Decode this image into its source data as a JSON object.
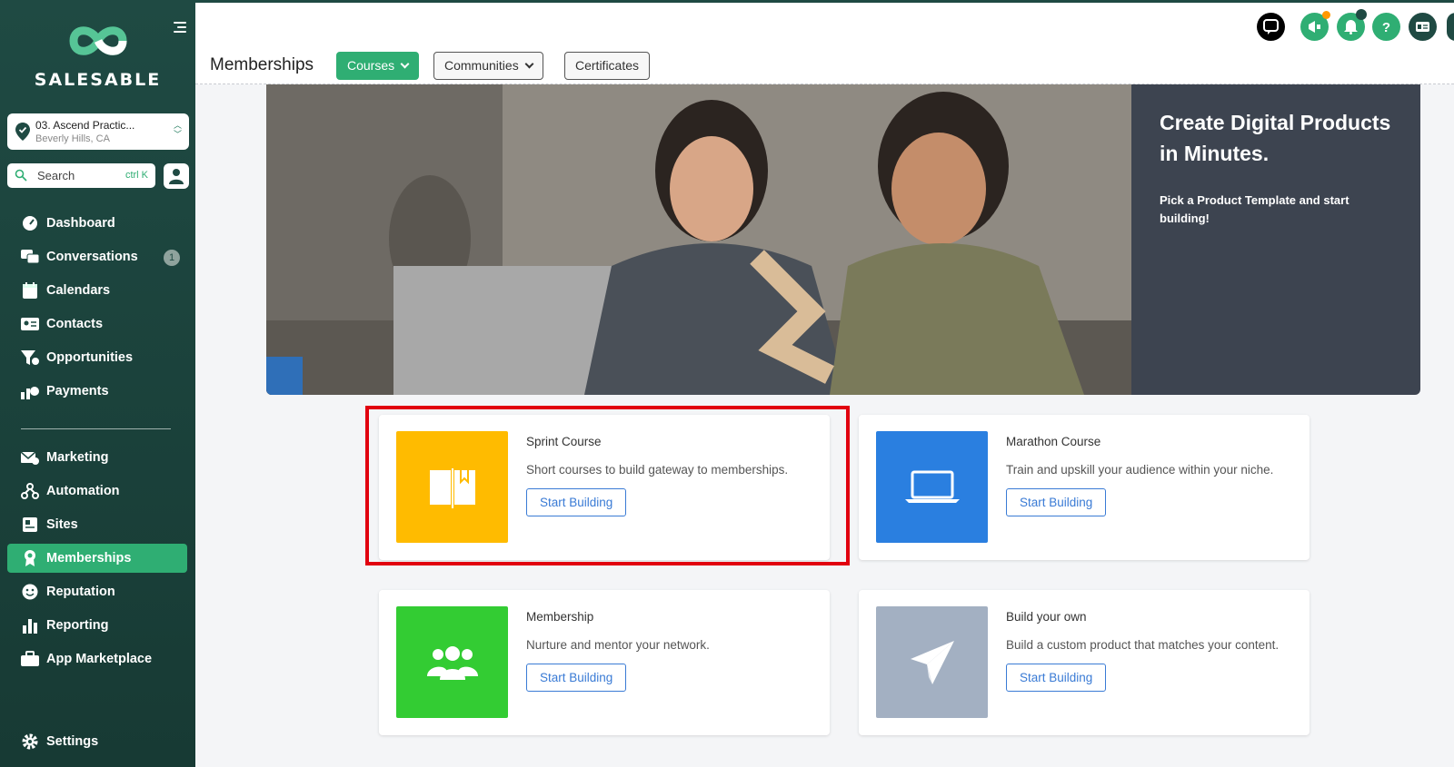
{
  "sidebar": {
    "brand": "SALESABLE",
    "location": {
      "name": "03. Ascend Practic...",
      "city": "Beverly Hills, CA"
    },
    "search": {
      "label": "Search",
      "shortcut": "ctrl K"
    },
    "items": [
      {
        "label": "Dashboard",
        "icon": "gauge-icon"
      },
      {
        "label": "Conversations",
        "icon": "chat-icon",
        "badge": "1"
      },
      {
        "label": "Calendars",
        "icon": "calendar-icon"
      },
      {
        "label": "Contacts",
        "icon": "contact-card-icon"
      },
      {
        "label": "Opportunities",
        "icon": "funnel-icon"
      },
      {
        "label": "Payments",
        "icon": "payments-icon"
      },
      {
        "label": "Marketing",
        "icon": "megaphone-mail-icon"
      },
      {
        "label": "Automation",
        "icon": "workflow-icon"
      },
      {
        "label": "Sites",
        "icon": "sites-icon"
      },
      {
        "label": "Memberships",
        "icon": "award-icon",
        "active": true
      },
      {
        "label": "Reputation",
        "icon": "smiley-icon"
      },
      {
        "label": "Reporting",
        "icon": "bar-chart-icon"
      },
      {
        "label": "App Marketplace",
        "icon": "briefcase-icon"
      },
      {
        "label": "Settings",
        "icon": "gear-icon"
      }
    ]
  },
  "header": {
    "page_title": "Memberships",
    "tabs": [
      {
        "label": "Courses",
        "style": "green"
      },
      {
        "label": "Communities",
        "style": "outline"
      },
      {
        "label": "Certificates",
        "style": "outline"
      }
    ]
  },
  "hero": {
    "title": "Create Digital Products in Minutes.",
    "subtitle": "Pick a Product Template and start building!"
  },
  "cards": [
    {
      "title": "Sprint Course",
      "desc": "Short courses to build gateway to memberships.",
      "button": "Start Building",
      "color": "#ffbb00",
      "icon": "book-icon"
    },
    {
      "title": "Marathon Course",
      "desc": "Train and upskill your audience within your niche.",
      "button": "Start Building",
      "color": "#2a7fe0",
      "icon": "laptop-icon"
    },
    {
      "title": "Membership",
      "desc": "Nurture and mentor your network.",
      "button": "Start Building",
      "color": "#33cc33",
      "icon": "group-icon"
    },
    {
      "title": "Build your own",
      "desc": "Build a custom product that matches your content.",
      "button": "Start Building",
      "color": "#a3b0c2",
      "icon": "paper-plane-icon"
    }
  ],
  "colors": {
    "sidebar": "#1f4a43",
    "accent": "#2fae73",
    "highlight": "#e1000f"
  }
}
